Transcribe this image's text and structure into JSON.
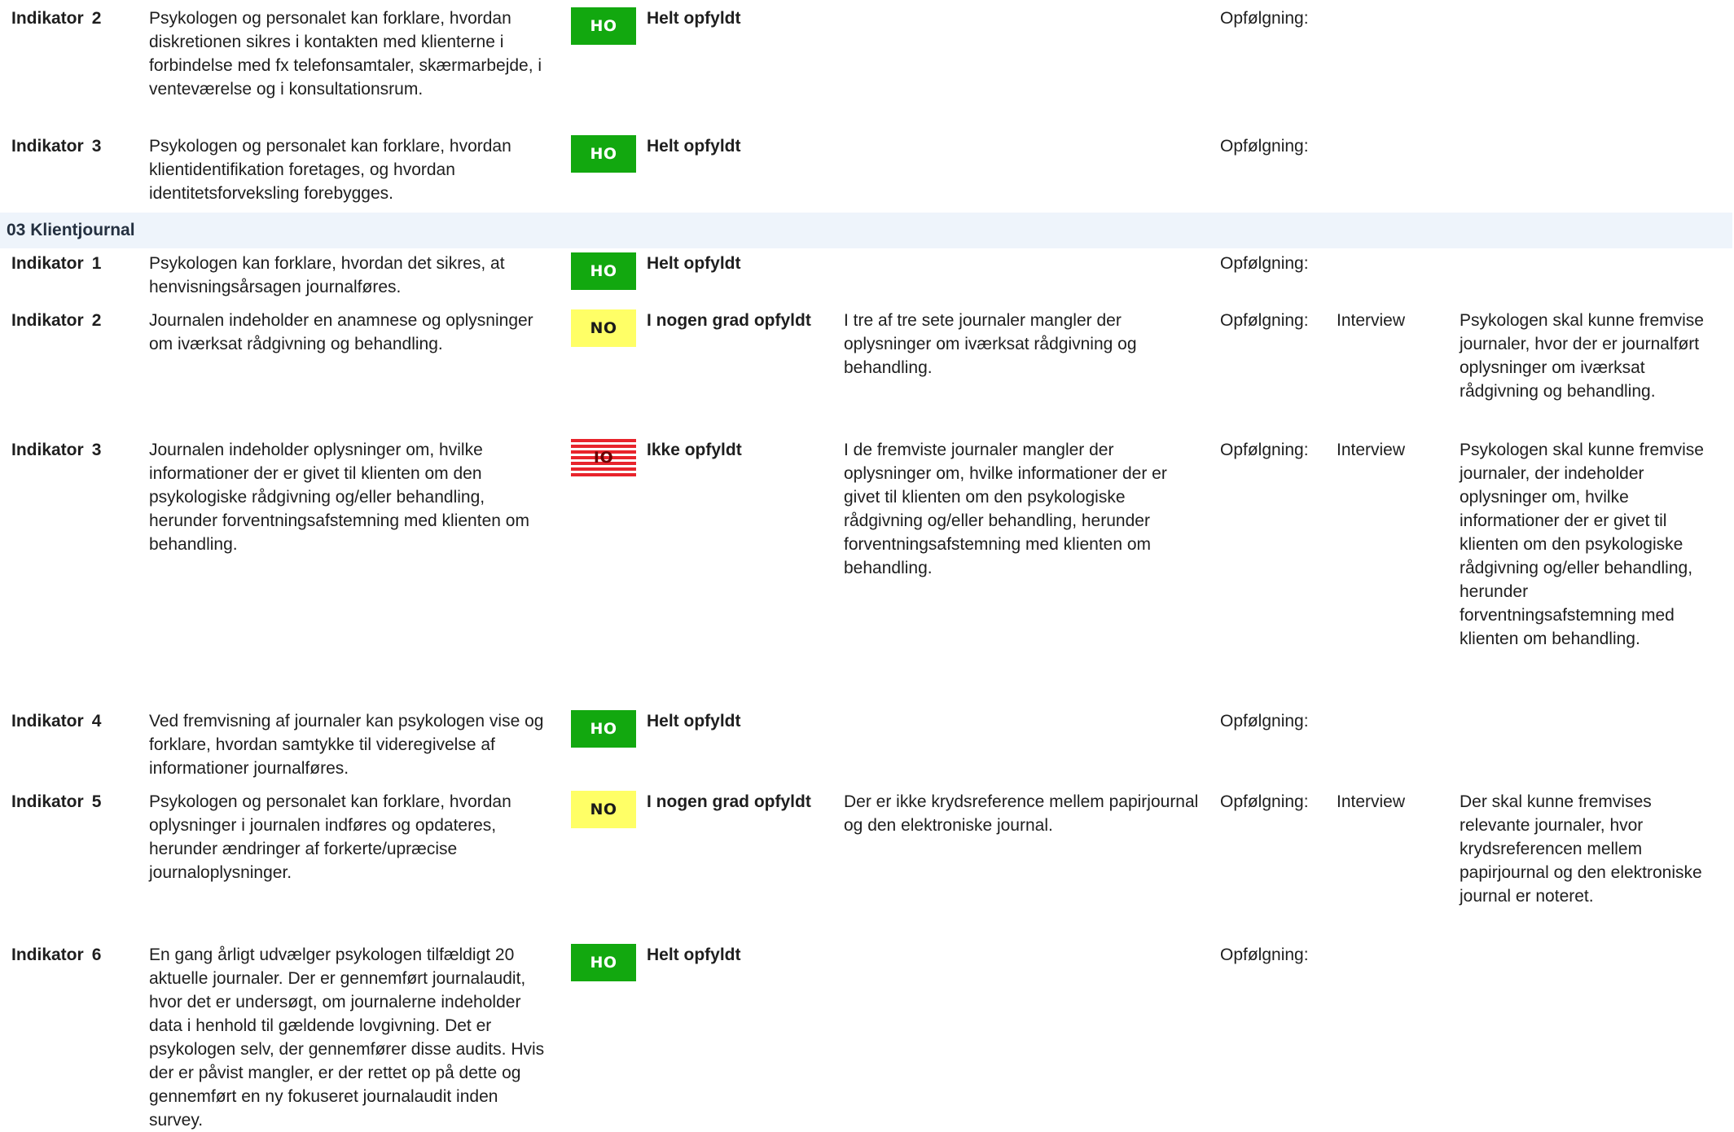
{
  "colors": {
    "ho_badge": "#12a80f",
    "no_badge": "#ffff66",
    "io_badge_stripe": "#e8242c",
    "section_header_bg": "#eef4fb"
  },
  "sections": [
    {
      "title": "",
      "rows": [
        {
          "label": "Indikator",
          "number": "2",
          "description": "Psykologen og personalet kan forklare, hvordan diskretionen sikres i kontakten med klienterne i forbindelse med fx telefonsamtaler, skærmarbejde, i venteværelse og i konsultationsrum.",
          "badge": "HO",
          "status": "Helt opfyldt",
          "finding": "",
          "followup_label": "Opfølgning:",
          "method": "",
          "requirement": ""
        },
        {
          "label": "Indikator",
          "number": "3",
          "description": "Psykologen og personalet kan forklare, hvordan klientidentifikation foretages, og hvordan identitetsforveksling forebygges.",
          "badge": "HO",
          "status": "Helt opfyldt",
          "finding": "",
          "followup_label": "Opfølgning:",
          "method": "",
          "requirement": ""
        }
      ]
    },
    {
      "title": "03 Klientjournal",
      "rows": [
        {
          "label": "Indikator",
          "number": "1",
          "description": "Psykologen kan forklare, hvordan det sikres, at henvisningsårsagen journalføres.",
          "badge": "HO",
          "status": "Helt opfyldt",
          "finding": "",
          "followup_label": "Opfølgning:",
          "method": "",
          "requirement": ""
        },
        {
          "label": "Indikator",
          "number": "2",
          "description": "Journalen indeholder en anamnese og oplysninger om iværksat rådgivning og behandling.",
          "badge": "NO",
          "status": "I nogen grad opfyldt",
          "finding": "I tre af tre sete journaler mangler der oplysninger om iværksat rådgivning og behandling.",
          "followup_label": "Opfølgning:",
          "method": "Interview",
          "requirement": "Psykologen skal kunne fremvise journaler, hvor der er journalført oplysninger om iværksat rådgivning og behandling."
        },
        {
          "label": "Indikator",
          "number": "3",
          "description": "Journalen indeholder oplysninger om, hvilke informationer der er givet til klienten om den psykologiske rådgivning og/eller behandling, herunder forventningsafstemning med klienten om behandling.",
          "badge": "IO",
          "status": "Ikke opfyldt",
          "finding": "I de fremviste journaler mangler der oplysninger om, hvilke informationer der er givet til klienten om den psykologiske rådgivning og/eller behandling, herunder forventningsafstemning med klienten om behandling.",
          "followup_label": "Opfølgning:",
          "method": "Interview",
          "requirement": "Psykologen skal kunne fremvise journaler, der indeholder oplysninger om, hvilke informationer der er givet til klienten om den psykologiske rådgivning og/eller behandling, herunder forventningsafstemning med klienten om behandling."
        },
        {
          "label": "Indikator",
          "number": "4",
          "description": "Ved fremvisning af journaler kan psykologen vise og forklare, hvordan samtykke til videregivelse af informationer journalføres.",
          "badge": "HO",
          "status": "Helt opfyldt",
          "finding": "",
          "followup_label": "Opfølgning:",
          "method": "",
          "requirement": ""
        },
        {
          "label": "Indikator",
          "number": "5",
          "description": "Psykologen og personalet kan forklare, hvordan oplysninger i journalen indføres og opdateres, herunder ændringer af forkerte/upræcise journaloplysninger.",
          "badge": "NO",
          "status": "I nogen grad opfyldt",
          "finding": "Der er ikke krydsreference mellem papirjournal og den elektroniske journal.",
          "followup_label": "Opfølgning:",
          "method": "Interview",
          "requirement": "Der skal kunne fremvises relevante journaler, hvor krydsreferencen mellem papirjournal og den elektroniske journal er noteret."
        },
        {
          "label": "Indikator",
          "number": "6",
          "description": "En gang årligt udvælger psykologen tilfældigt 20 aktuelle journaler. Der er gennemført journalaudit, hvor det er undersøgt, om journalerne indeholder data i henhold til gældende lovgivning. Det er psykologen selv, der gennemfører disse audits. Hvis der er påvist mangler, er der rettet op på dette og gennemført en ny fokuseret journalaudit inden survey.",
          "badge": "HO",
          "status": "Helt opfyldt",
          "finding": "",
          "followup_label": "Opfølgning:",
          "method": "",
          "requirement": ""
        }
      ]
    }
  ]
}
